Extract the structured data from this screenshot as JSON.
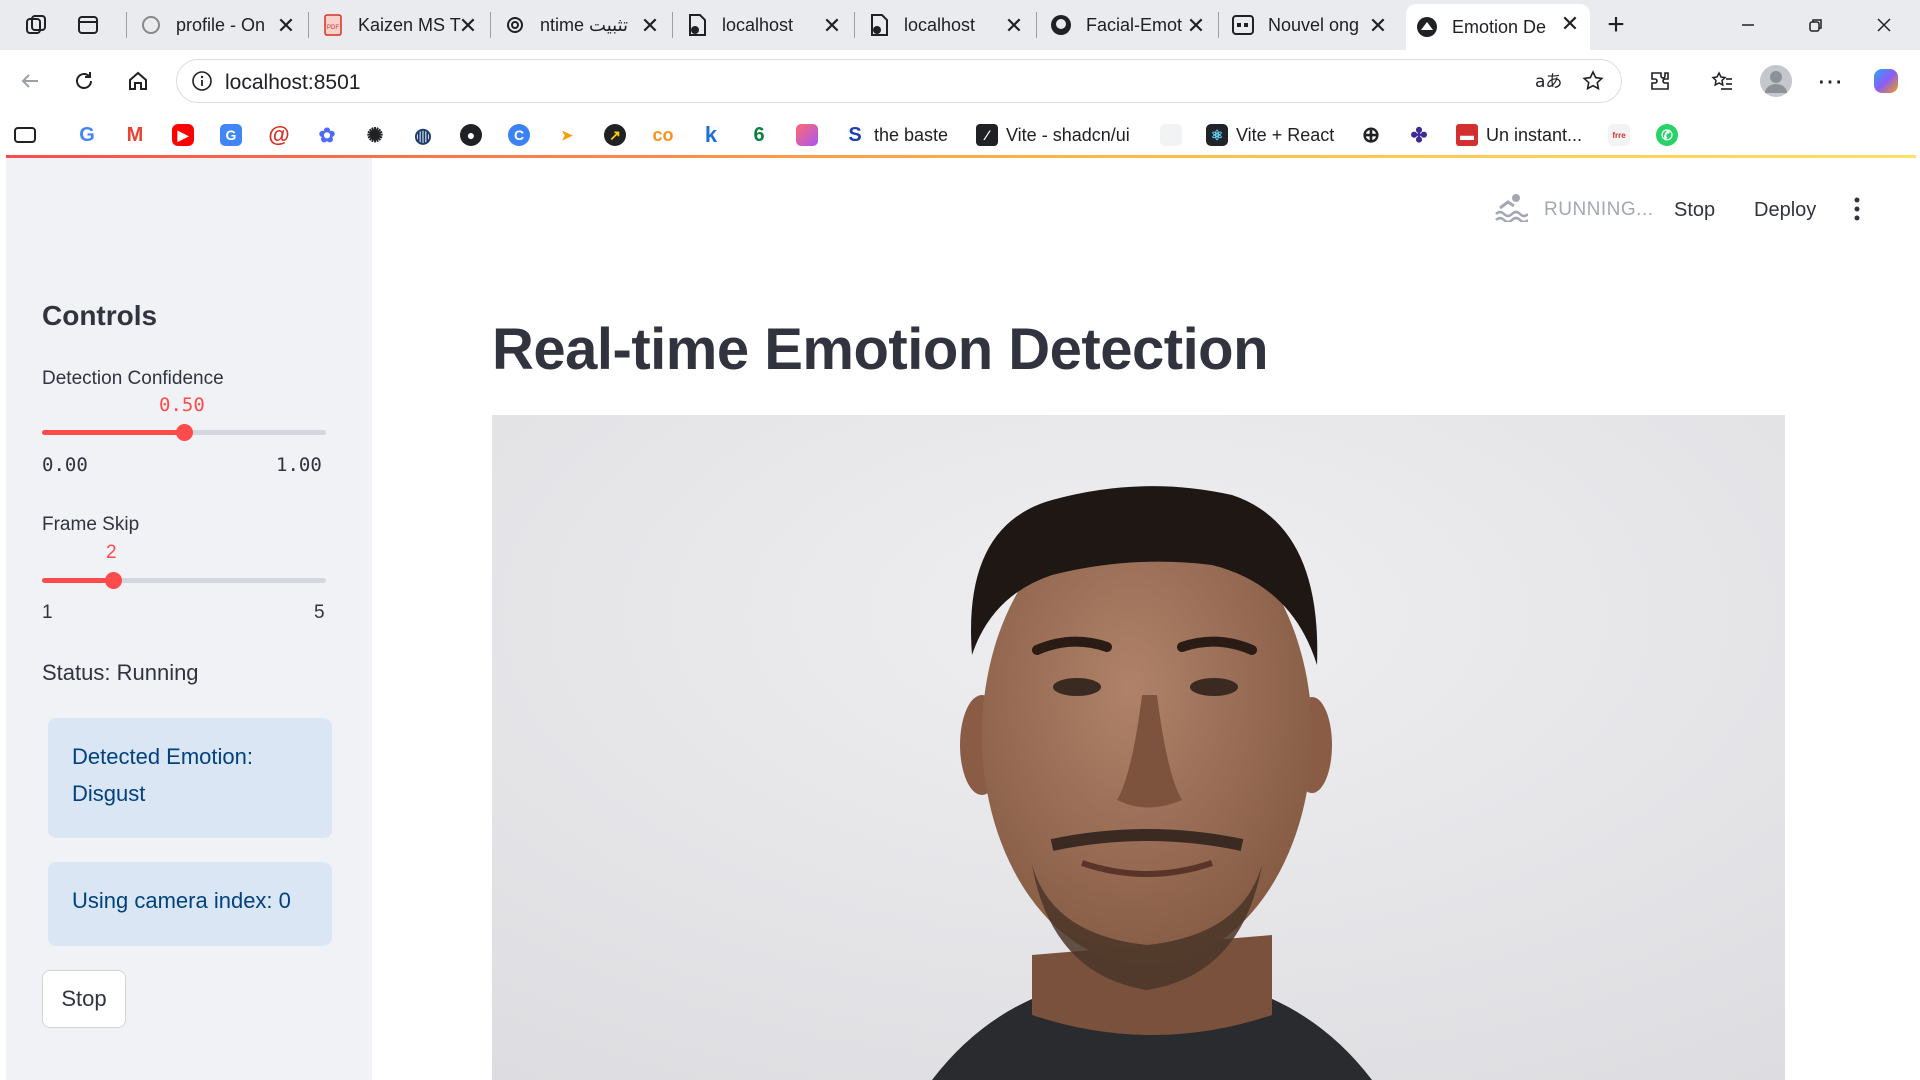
{
  "browser": {
    "tabs": [
      {
        "label": "profile - On",
        "icon": "openai-icon"
      },
      {
        "label": "Kaizen MS T",
        "icon": "pdf-icon"
      },
      {
        "label": "ntime تثبيت",
        "icon": "openai-icon"
      },
      {
        "label": "localhost",
        "icon": "page-icon"
      },
      {
        "label": "localhost",
        "icon": "page-icon"
      },
      {
        "label": "Facial-Emot",
        "icon": "github-icon"
      },
      {
        "label": "Nouvel ong",
        "icon": "page-icon"
      },
      {
        "label": "Emotion De",
        "icon": "streamlit-icon",
        "active": true
      }
    ],
    "url": "localhost:8501",
    "bookmarks": [
      {
        "label": "the baste"
      },
      {
        "label": "Vite - shadcn/ui"
      },
      {
        "label": "Vite + React"
      },
      {
        "label": "Un instant..."
      }
    ]
  },
  "header": {
    "status": "RUNNING...",
    "stop_label": "Stop",
    "deploy_label": "Deploy"
  },
  "sidebar": {
    "title": "Controls",
    "confidence": {
      "label": "Detection Confidence",
      "value": "0.50",
      "min": "0.00",
      "max": "1.00",
      "fraction": 0.5
    },
    "frame_skip": {
      "label": "Frame Skip",
      "value": "2",
      "min": "1",
      "max": "5",
      "fraction": 0.25
    },
    "status_text": "Status: Running",
    "emotion_label": "Detected Emotion:",
    "emotion_value": "Disgust",
    "camera_text": "Using camera index: 0",
    "stop_label": "Stop"
  },
  "main": {
    "title": "Real-time Emotion Detection"
  },
  "colors": {
    "accent": "#ff4b4b",
    "sidebar_bg": "#f0f2f6",
    "info_bg": "#dbe6f4",
    "info_text": "#004280"
  }
}
